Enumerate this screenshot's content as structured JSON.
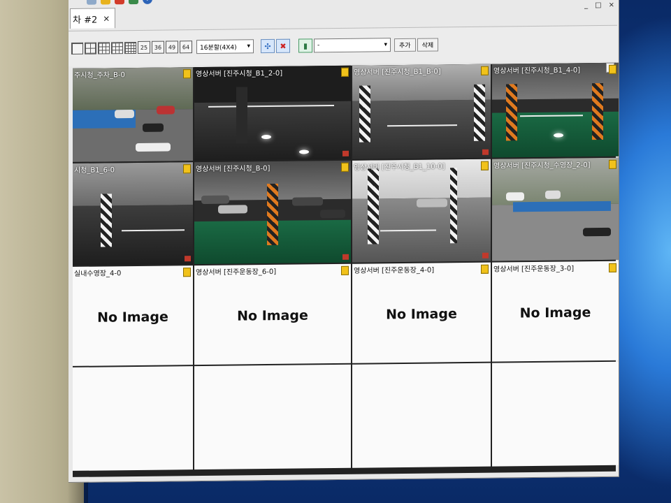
{
  "window": {
    "tab_label": "차 #2",
    "tab_close": "×",
    "controls": [
      "_",
      "□",
      "×"
    ]
  },
  "toolbar": {
    "split_buttons": [
      "25",
      "36",
      "49",
      "64"
    ],
    "split_select": "16분할(4X4)",
    "device_select": "-",
    "add_label": "추가",
    "delete_label": "삭제",
    "help_glyph": "?"
  },
  "cameras": [
    {
      "label": "주시청_주차_B-0",
      "state": "live",
      "scene": "outdoor"
    },
    {
      "label": "영상서버 [진주시청_B1_2-0]",
      "state": "live",
      "scene": "dark"
    },
    {
      "label": "영상서버 [진주시청_B1_B-0]",
      "state": "live",
      "scene": "gray"
    },
    {
      "label": "영상서버 [진주시청_B1_4-0]",
      "state": "live",
      "scene": "green"
    },
    {
      "label": "시청_B1_6-0",
      "state": "live",
      "scene": "gray"
    },
    {
      "label": "영상서버 [진주시청_B-0]",
      "state": "live",
      "scene": "green-cars"
    },
    {
      "label": "영상서버 [진주시청_B1_10-0]",
      "state": "live",
      "scene": "bright"
    },
    {
      "label": "영상서버 [진주시청_수영장_2-0]",
      "state": "live",
      "scene": "outdoor2"
    },
    {
      "label": "실내수영장_4-0",
      "state": "empty",
      "message": "No Image"
    },
    {
      "label": "영상서버 [진주운동장_6-0]",
      "state": "empty",
      "message": "No Image"
    },
    {
      "label": "영상서버 [진주운동장_4-0]",
      "state": "empty",
      "message": "No Image"
    },
    {
      "label": "영상서버 [진주운동장_3-0]",
      "state": "empty",
      "message": "No Image"
    },
    {
      "label": "",
      "state": "blank"
    },
    {
      "label": "",
      "state": "blank"
    },
    {
      "label": "",
      "state": "blank"
    },
    {
      "label": "",
      "state": "blank"
    }
  ],
  "colors": {
    "badge": "#f1c21b",
    "rec": "#c0392b",
    "wallpaper": "#0b2d6e"
  }
}
